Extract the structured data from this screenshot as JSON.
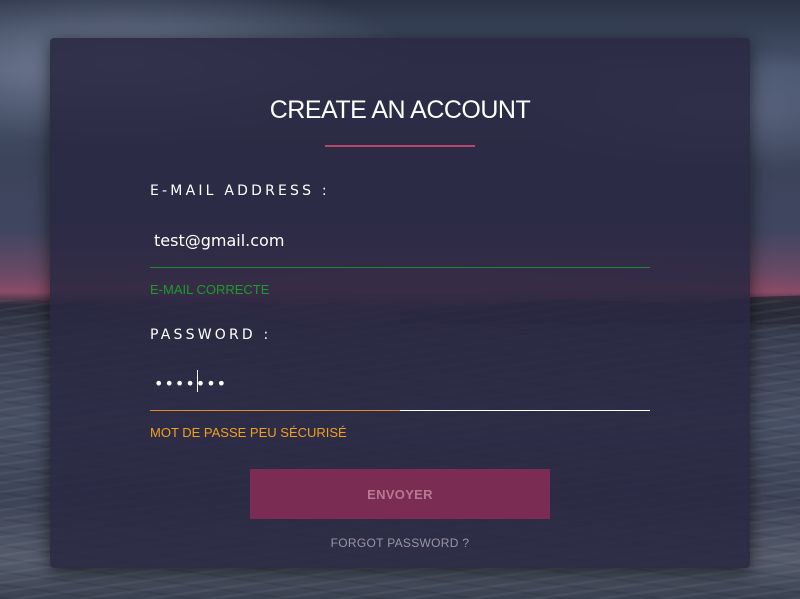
{
  "form": {
    "title": "CREATE AN ACCOUNT",
    "email": {
      "label": "E-MAIL ADDRESS :",
      "value": "test@gmail.com",
      "status": "E-MAIL CORRECTE",
      "status_color": "#1f9a2c"
    },
    "password": {
      "label": "PASSWORD :",
      "value": "•••••••",
      "status": "MOT DE PASSE PEU SÉCURISÉ",
      "status_color": "#f0a020",
      "strength": 0.5
    },
    "submit_label": "ENVOYER",
    "forgot_link": "FORGOT PASSWORD ?"
  },
  "colors": {
    "accent": "#b8456a",
    "button_bg": "#7a2c52",
    "card_bg": "#2a2842"
  }
}
